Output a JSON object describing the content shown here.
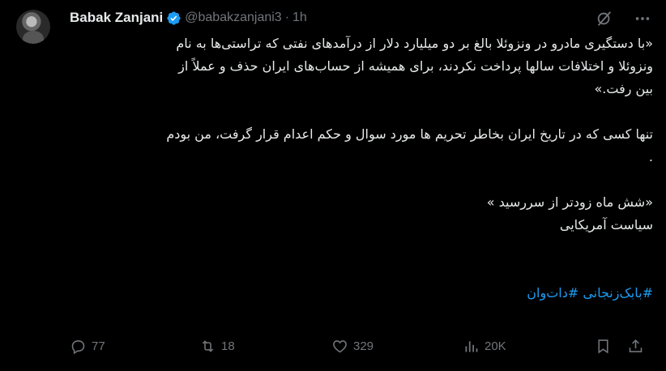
{
  "author": {
    "name": "Babak Zanjani",
    "handle": "@babakzanjani3",
    "separator": "·",
    "time": "1h"
  },
  "tweet": {
    "lines": [
      "«با دستگیری مادرو  در ونزوئلا بالغ بر دو میلیارد دلار از درآمدهای نفتی که تراستی‌ها به نام",
      "ونزوئلا  و اختلافات سالها پرداخت نکردند، برای همیشه از حساب‌های ایران حذف و عملاً از",
      "بین رفت.»",
      "",
      "تنها کسی که در تاریخ ایران بخاطر تحریم ها مورد سوال و حکم اعدام قرار گرفت، من بودم",
      ".",
      "",
      "«شش ماه زودتر از  سررسید »",
      "سیاست آمریکایی",
      "",
      ""
    ],
    "hashtags": "#بابک‌زنجانی #دات‌وان"
  },
  "actions": {
    "replies": "77",
    "reposts": "18",
    "likes": "329",
    "views": "20K"
  },
  "colors": {
    "background": "#000000",
    "text": "#e7e9ea",
    "muted": "#71767b",
    "accent": "#1d9bf0"
  },
  "icons": [
    "verified-badge-icon",
    "grok-icon",
    "more-icon",
    "reply-icon",
    "repost-icon",
    "like-icon",
    "views-icon",
    "bookmark-icon",
    "share-icon"
  ]
}
